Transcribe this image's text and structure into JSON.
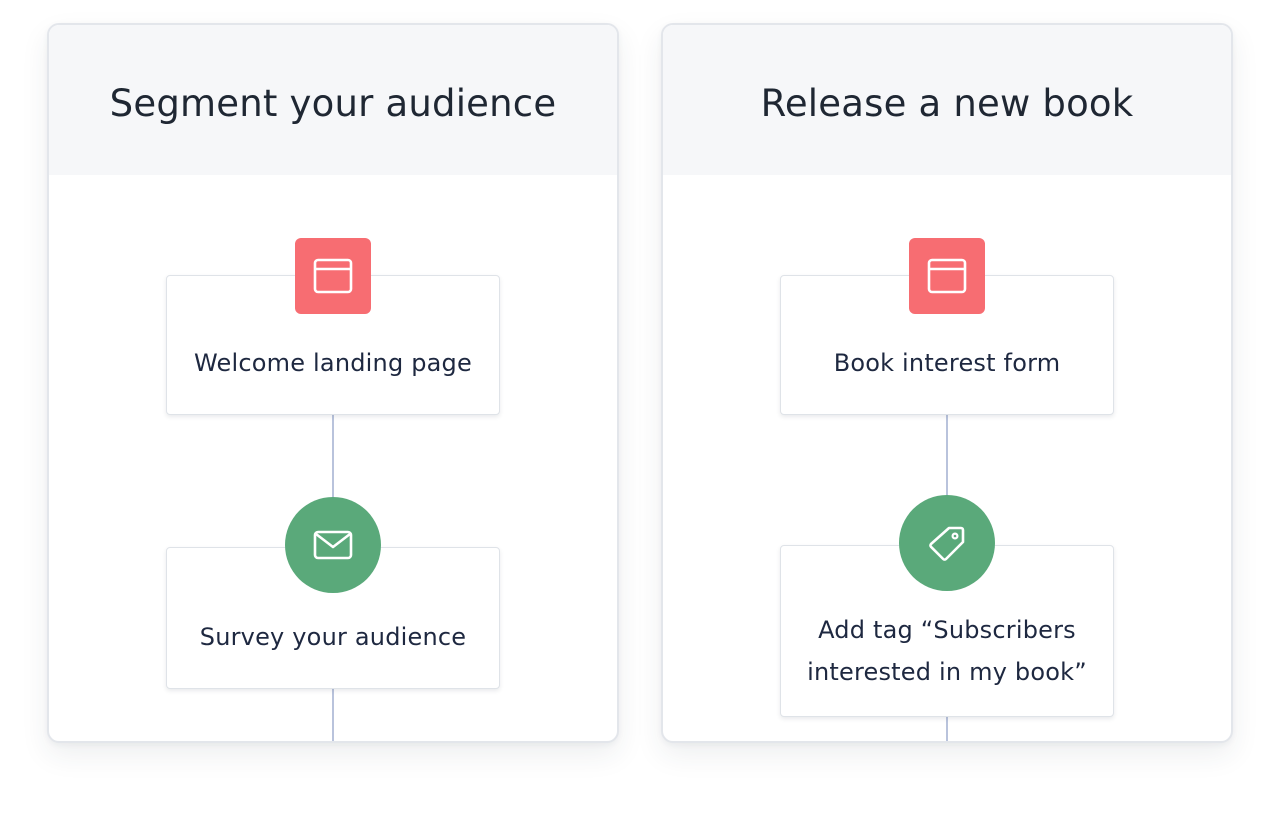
{
  "colors": {
    "card_header_bg": "#f6f7f9",
    "landing_page_badge": "#f76d72",
    "action_badge": "#5aa97a",
    "connector_line": "#b9c3dc"
  },
  "cards": [
    {
      "title": "Segment your audience",
      "steps": [
        {
          "label": "Welcome landing page",
          "icon": "browser-window-icon",
          "badge_color": "#f76d72"
        },
        {
          "label": "Survey your audience",
          "icon": "envelope-icon",
          "badge_color": "#5aa97a"
        }
      ]
    },
    {
      "title": "Release a new book",
      "steps": [
        {
          "label": "Book interest form",
          "icon": "browser-window-icon",
          "badge_color": "#f76d72"
        },
        {
          "label": "Add tag “Subscribers interested in my book”",
          "icon": "tag-icon",
          "badge_color": "#5aa97a"
        }
      ]
    }
  ]
}
